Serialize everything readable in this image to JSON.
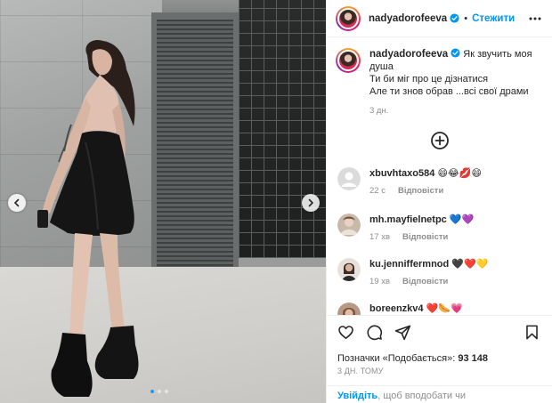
{
  "post": {
    "username": "nadyadorofeeva",
    "follow_label": "Стежити",
    "caption_lines": [
      "Як звучить моя душа",
      "Ти би міг про це дізнатися",
      "Але ти знов обрав ...всі свої драми"
    ],
    "caption_time": "3 дн.",
    "likes_label": "Позначки «Подобається»:",
    "likes_count": "93 148",
    "post_time": "3 ДН. ТОМУ"
  },
  "carousel": {
    "slide_count": 3,
    "active_index": 1
  },
  "comments": [
    {
      "username": "xbuvhtaxo584",
      "text": "😄😂💋😄",
      "time": "22 с",
      "reply": "Відповісти",
      "avatar": "default-avatar"
    },
    {
      "username": "mh.mayfielnetpc",
      "text": "💙💜",
      "time": "17 хв",
      "reply": "Відповісти",
      "avatar": "photo-avatar"
    },
    {
      "username": "ku.jenniffermnod",
      "text": "🖤❤️💛",
      "time": "19 хв",
      "reply": "Відповісти",
      "avatar": "photo-avatar"
    },
    {
      "username": "boreenzkv4",
      "text": "❤️🌭💗",
      "time": "",
      "reply": "",
      "avatar": "photo-avatar"
    }
  ],
  "login_bar": {
    "link": "Увійдіть",
    "text": ", щоб вподобати чи прокоментувати."
  },
  "icons": {
    "verified": "verified-badge-icon",
    "more": "more-options-icon",
    "add": "add-circle-icon",
    "like": "heart-icon",
    "comment": "comment-icon",
    "share": "share-icon",
    "save": "bookmark-icon"
  },
  "colors": {
    "accent": "#0095f6",
    "verified": "#0095f6",
    "muted": "#8e8e8e",
    "text": "#262626"
  }
}
